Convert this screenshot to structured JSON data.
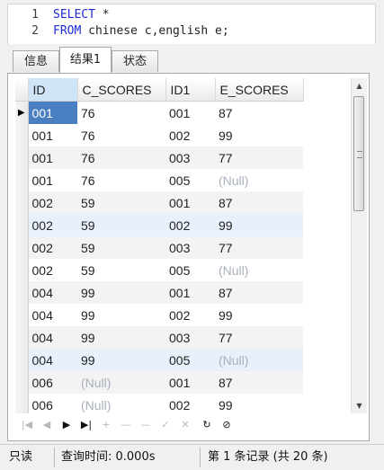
{
  "editor": {
    "lines": [
      {
        "num": "1",
        "kw": "SELECT",
        "rest": " *"
      },
      {
        "num": "2",
        "kw": "FROM",
        "rest": " chinese c,english e;"
      }
    ]
  },
  "tabs": [
    {
      "label": "信息",
      "active": false
    },
    {
      "label": "结果1",
      "active": true
    },
    {
      "label": "状态",
      "active": false
    }
  ],
  "grid": {
    "columns": [
      "ID",
      "C_SCORES",
      "ID1",
      "E_SCORES"
    ],
    "rows": [
      [
        "001",
        "76",
        "001",
        "87"
      ],
      [
        "001",
        "76",
        "002",
        "99"
      ],
      [
        "001",
        "76",
        "003",
        "77"
      ],
      [
        "001",
        "76",
        "005",
        "(Null)"
      ],
      [
        "002",
        "59",
        "001",
        "87"
      ],
      [
        "002",
        "59",
        "002",
        "99"
      ],
      [
        "002",
        "59",
        "003",
        "77"
      ],
      [
        "002",
        "59",
        "005",
        "(Null)"
      ],
      [
        "004",
        "99",
        "001",
        "87"
      ],
      [
        "004",
        "99",
        "002",
        "99"
      ],
      [
        "004",
        "99",
        "003",
        "77"
      ],
      [
        "004",
        "99",
        "005",
        "(Null)"
      ],
      [
        "006",
        "(Null)",
        "001",
        "87"
      ],
      [
        "006",
        "(Null)",
        "002",
        "99"
      ]
    ],
    "current_row_indicator": "▶",
    "null_text": "(Null)"
  },
  "navigator": {
    "icons": [
      "first-record-icon",
      "prev-record-icon",
      "next-record-icon",
      "last-record-icon",
      "add-record-icon",
      "delete-record-icon",
      "save-record-icon",
      "cancel-edit-icon",
      "refresh-icon",
      "stop-icon"
    ]
  },
  "status": {
    "mode": "只读",
    "query_time": "查询时间: 0.000s",
    "record_info": "第 1 条记录 (共 20 条)"
  },
  "colors": {
    "keyword": "#1c2bd6",
    "selection": "#4a7fc1",
    "null": "#a8b0bd"
  }
}
